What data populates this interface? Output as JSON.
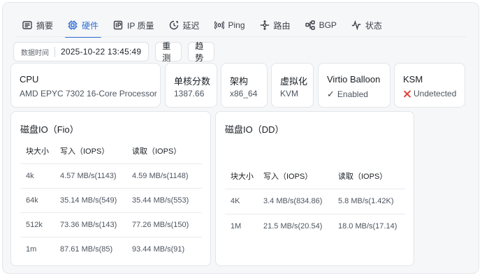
{
  "tabs": [
    {
      "label": "摘要",
      "icon": "summary-icon"
    },
    {
      "label": "硬件",
      "icon": "chip-icon",
      "active": true
    },
    {
      "label": "IP 质量",
      "icon": "ip-icon"
    },
    {
      "label": "延迟",
      "icon": "latency-icon"
    },
    {
      "label": "Ping",
      "icon": "ping-icon"
    },
    {
      "label": "路由",
      "icon": "route-icon"
    },
    {
      "label": "BGP",
      "icon": "bgp-icon"
    },
    {
      "label": "状态",
      "icon": "status-icon"
    }
  ],
  "controls": {
    "time_label": "数据时间",
    "time_value": "2025-10-22 13:45:49",
    "retest_label": "重测",
    "trend_label": "趋势"
  },
  "info": {
    "cpu": {
      "title": "CPU",
      "value": "AMD EPYC 7302 16-Core Processor"
    },
    "single_core": {
      "title": "单核分数",
      "value": "1387.66"
    },
    "arch": {
      "title": "架构",
      "value": "x86_64"
    },
    "virt": {
      "title": "虚拟化",
      "value": "KVM"
    },
    "balloon": {
      "title": "Virtio Balloon",
      "value": "Enabled"
    },
    "ksm": {
      "title": "KSM",
      "value": "Undetected"
    }
  },
  "fio": {
    "title": "磁盘IO（Fio）",
    "headers": [
      "块大小",
      "写入（IOPS）",
      "读取（IOPS）"
    ],
    "rows": [
      [
        "4k",
        "4.57 MB/s(1143)",
        "4.59 MB/s(1148)"
      ],
      [
        "64k",
        "35.14 MB/s(549)",
        "35.44 MB/s(553)"
      ],
      [
        "512k",
        "73.36 MB/s(143)",
        "77.26 MB/s(150)"
      ],
      [
        "1m",
        "87.61 MB/s(85)",
        "93.44 MB/s(91)"
      ]
    ]
  },
  "dd": {
    "title": "磁盘IO（DD）",
    "headers": [
      "块大小",
      "写入（IOPS）",
      "读取（IOPS）"
    ],
    "rows": [
      [
        "4K",
        "3.4 MB/s(834.86)",
        "5.8 MB/s(1.42K)"
      ],
      [
        "1M",
        "21.5 MB/s(20.54)",
        "18.0 MB/s(17.14)"
      ]
    ]
  },
  "colors": {
    "accent": "#2f6fd6",
    "error": "#e0443e"
  }
}
